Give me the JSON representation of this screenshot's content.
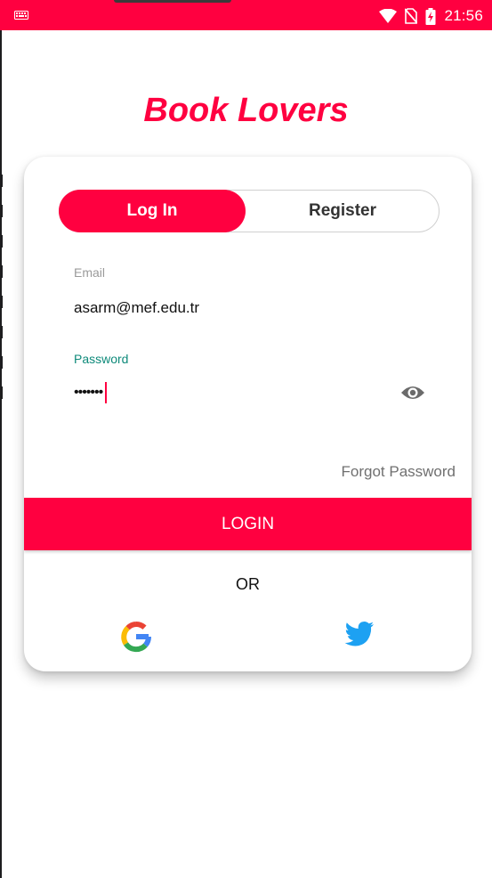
{
  "status_bar": {
    "time": "21:56",
    "icons": [
      "keyboard-icon",
      "wifi-icon",
      "no-sim-icon",
      "battery-charging-icon"
    ]
  },
  "app": {
    "title": "Book Lovers"
  },
  "tabs": {
    "login_label": "Log In",
    "register_label": "Register",
    "active": "Log In"
  },
  "form": {
    "email_label": "Email",
    "email_value": "asarm@mef.edu.tr",
    "password_label": "Password",
    "password_value": "•••••••",
    "password_toggle_icon": "eye-icon",
    "forgot_password": "Forgot Password",
    "login_button": "LOGIN",
    "or_text": "OR"
  },
  "social": {
    "google_icon": "google-icon",
    "twitter_icon": "twitter-icon"
  },
  "colors": {
    "accent": "#ff0040",
    "focused_label": "#0e8a7a",
    "twitter_blue": "#1da1f2"
  }
}
